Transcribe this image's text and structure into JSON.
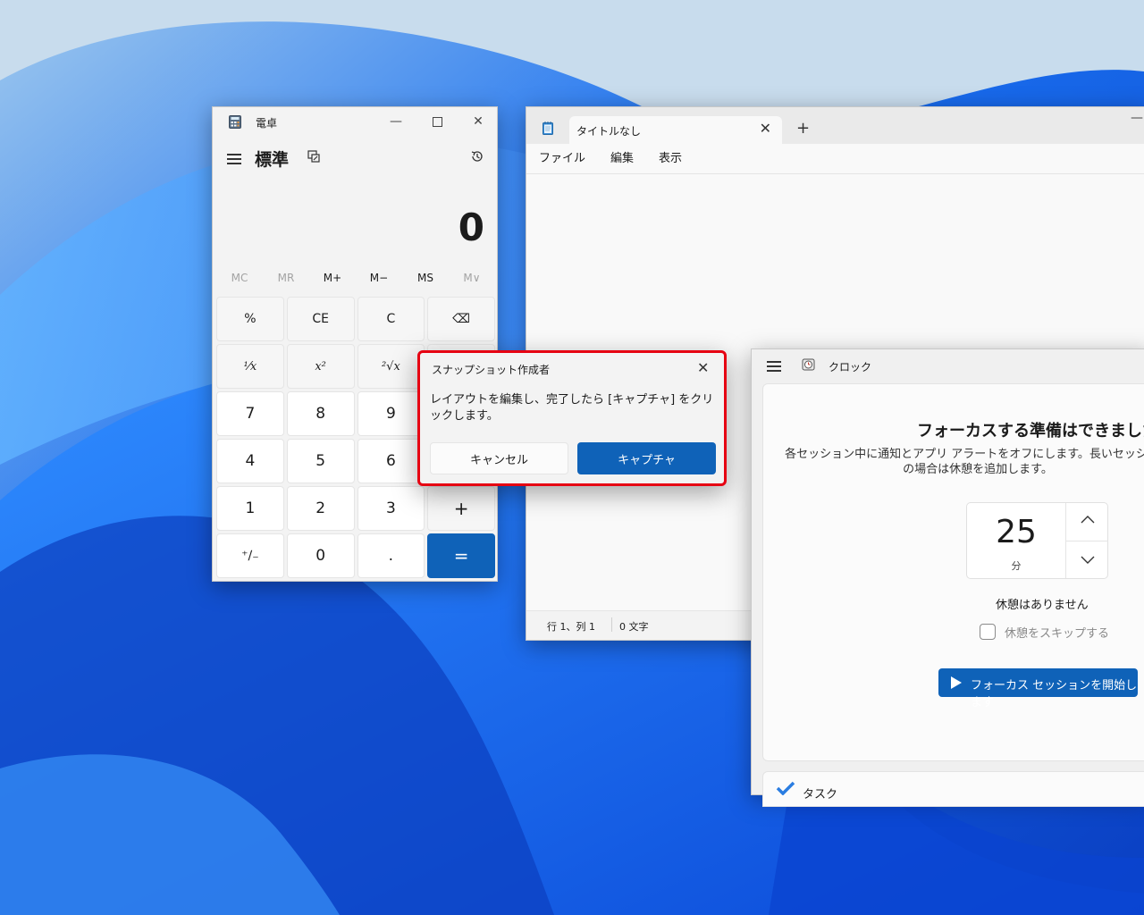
{
  "calculator": {
    "title": "電卓",
    "mode": "標準",
    "display": "0",
    "memory_buttons": [
      {
        "label": "MC",
        "enabled": false
      },
      {
        "label": "MR",
        "enabled": false
      },
      {
        "label": "M+",
        "enabled": true
      },
      {
        "label": "M−",
        "enabled": true
      },
      {
        "label": "MS",
        "enabled": true
      },
      {
        "label": "M∨",
        "enabled": false
      }
    ],
    "keys": {
      "percent": "%",
      "ce": "CE",
      "c": "C",
      "backspace": "⌫",
      "reciprocal": "¹⁄x",
      "square": "x²",
      "sqrt": "²√x",
      "divide": "÷",
      "seven": "7",
      "eight": "8",
      "nine": "9",
      "multiply": "×",
      "four": "4",
      "five": "5",
      "six": "6",
      "minus": "−",
      "one": "1",
      "two": "2",
      "three": "3",
      "plus": "+",
      "negate": "⁺∕₋",
      "zero": "0",
      "decimal": ".",
      "equals": "="
    }
  },
  "notepad": {
    "tab_title": "タイトルなし",
    "new_tab": "+",
    "menu": {
      "file": "ファイル",
      "edit": "編集",
      "view": "表示"
    },
    "status": {
      "position": "行 1、列 1",
      "chars": "0 文字"
    }
  },
  "clock": {
    "title": "クロック",
    "heading": "フォーカスする準備はできましたか",
    "description": "各セッション中に通知とアプリ アラートをオフにします。長いセッションの場合は休憩を追加します。",
    "minutes_value": "25",
    "minutes_unit": "分",
    "no_breaks": "休憩はありません",
    "skip_breaks": "休憩をスキップする",
    "start_button": "フォーカス セッションを開始します",
    "tasks_label": "タスク"
  },
  "snapshot_dialog": {
    "title": "スナップショット作成者",
    "message": "レイアウトを編集し、完了したら [キャプチャ] をクリックします。",
    "cancel": "キャンセル",
    "capture": "キャプチャ"
  },
  "colors": {
    "accent": "#0f62b8",
    "highlight_border": "#e60012"
  }
}
